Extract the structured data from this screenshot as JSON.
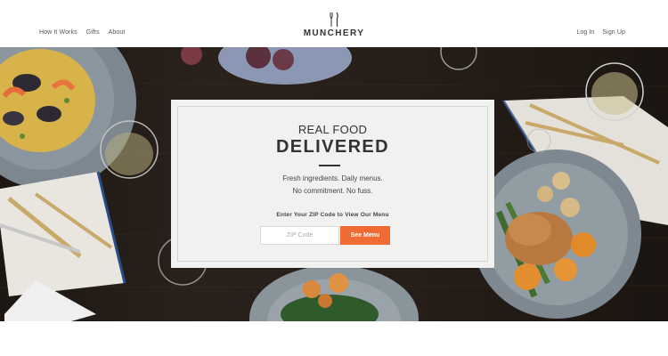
{
  "header": {
    "nav_left": [
      "How It Works",
      "Gifts",
      "About"
    ],
    "brand": "MUNCHERY",
    "nav_right": [
      "Log In",
      "Sign Up"
    ]
  },
  "hero": {
    "title_line_1": "REAL FOOD",
    "title_line_2": "DELIVERED",
    "subtitle_line_1": "Fresh ingredients. Daily menus.",
    "subtitle_line_2": "No commitment. No fuss.",
    "zip_prompt": "Enter Your ZIP Code to View Our Menu",
    "zip_placeholder": "ZIP Code",
    "zip_value": "",
    "cta_label": "See Menu"
  },
  "colors": {
    "accent": "#ef6b33",
    "text": "#333333",
    "card_bg": "#f1f1f0"
  }
}
